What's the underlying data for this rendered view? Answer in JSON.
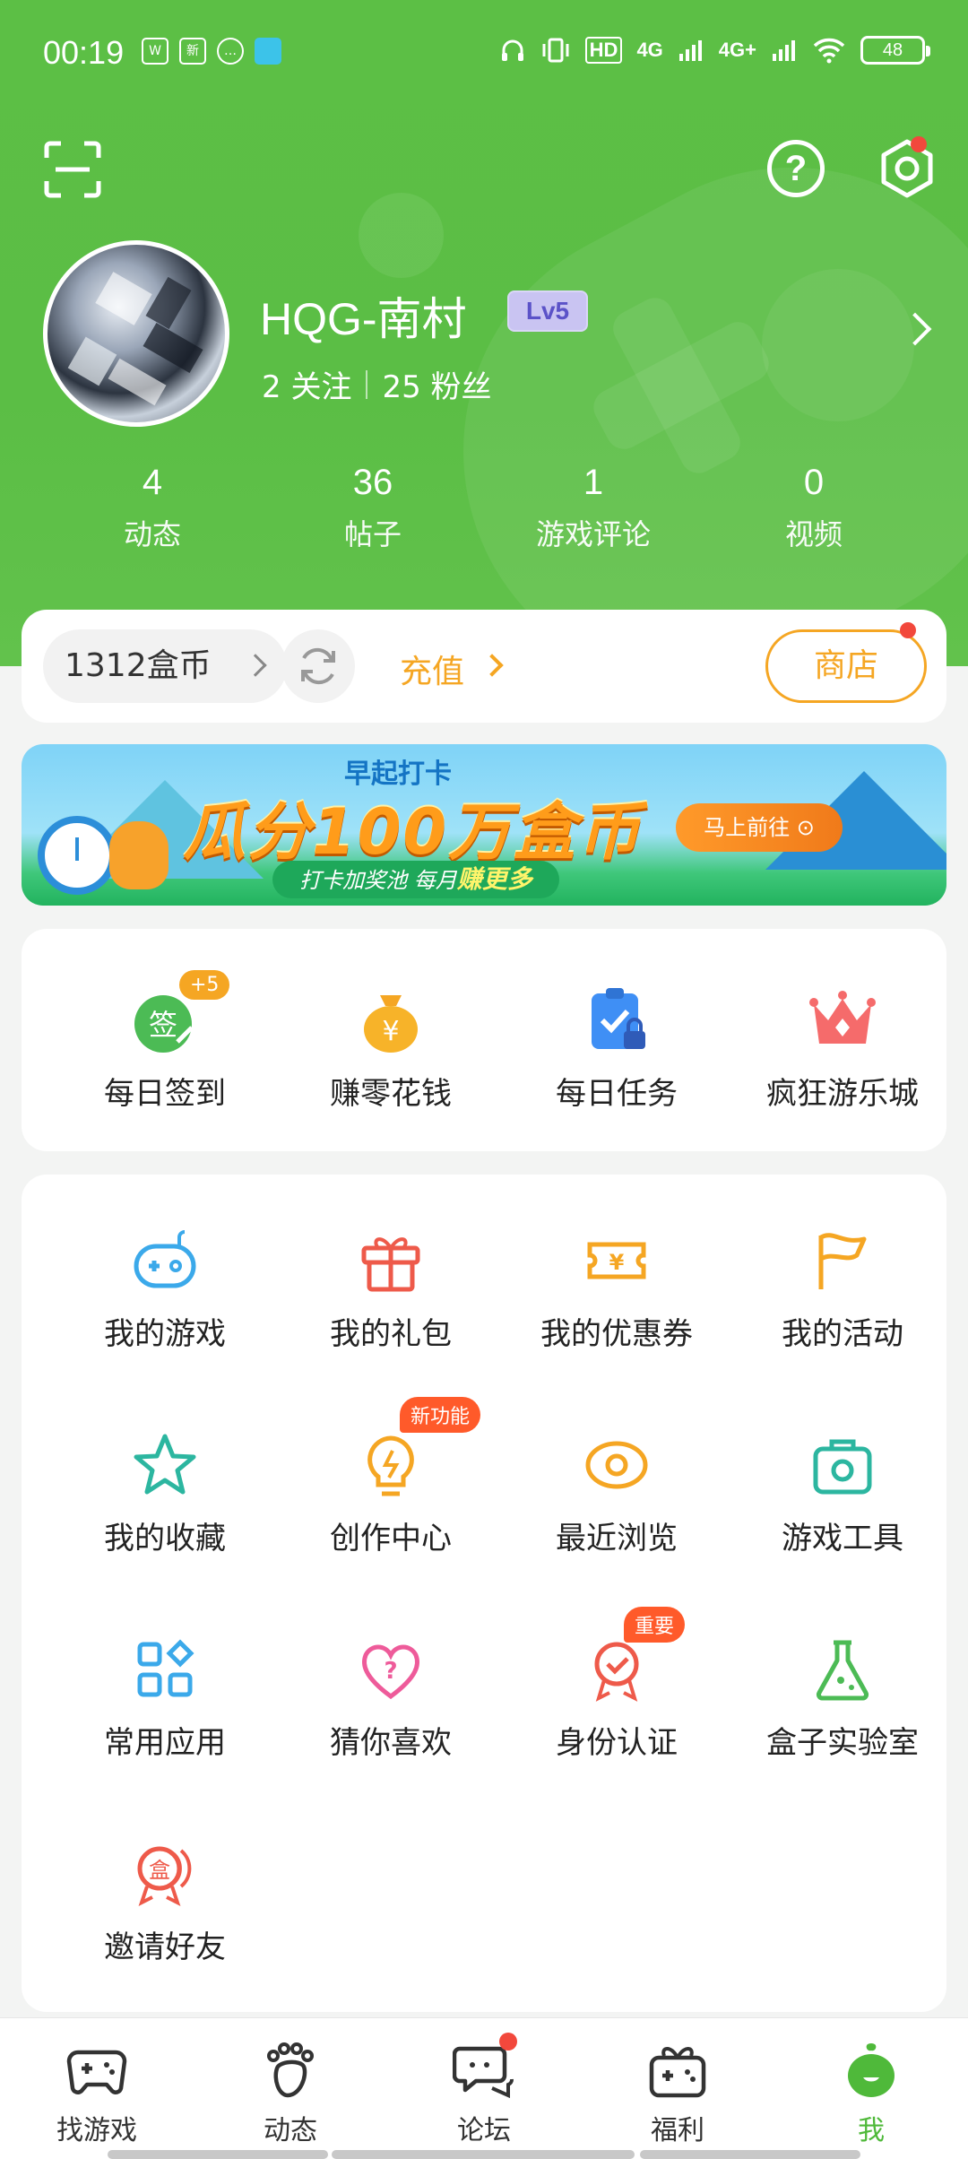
{
  "status_bar": {
    "time": "00:19",
    "battery": "48",
    "network": [
      "HD",
      "4G",
      "4G+"
    ]
  },
  "profile": {
    "username": "HQG-南村",
    "level": "Lv5",
    "following": "2 关注",
    "followers": "25 粉丝"
  },
  "stats": [
    {
      "num": "4",
      "label": "动态"
    },
    {
      "num": "36",
      "label": "帖子"
    },
    {
      "num": "1",
      "label": "游戏评论"
    },
    {
      "num": "0",
      "label": "视频"
    }
  ],
  "coins": {
    "balance": "1312盒币",
    "recharge": "充值",
    "shop": "商店"
  },
  "banner": {
    "subtitle": "早起打卡",
    "title": "瓜分100万盒币",
    "tag_prefix": "打卡加奖池  每月",
    "tag_highlight": "赚更多",
    "button": "马上前往 ⊙"
  },
  "quick_actions": [
    {
      "label": "每日签到",
      "icon": "sign-in-icon",
      "badge": "+5"
    },
    {
      "label": "赚零花钱",
      "icon": "money-bag-icon"
    },
    {
      "label": "每日任务",
      "icon": "task-clipboard-icon"
    },
    {
      "label": "疯狂游乐城",
      "icon": "crown-icon"
    }
  ],
  "features": [
    {
      "label": "我的游戏",
      "icon": "gamepad-icon"
    },
    {
      "label": "我的礼包",
      "icon": "gift-icon"
    },
    {
      "label": "我的优惠券",
      "icon": "coupon-icon"
    },
    {
      "label": "我的活动",
      "icon": "flag-icon"
    },
    {
      "label": "我的收藏",
      "icon": "star-icon"
    },
    {
      "label": "创作中心",
      "icon": "bulb-icon",
      "badge": "新功能"
    },
    {
      "label": "最近浏览",
      "icon": "eye-icon"
    },
    {
      "label": "游戏工具",
      "icon": "toolbox-icon"
    },
    {
      "label": "常用应用",
      "icon": "apps-icon"
    },
    {
      "label": "猜你喜欢",
      "icon": "heart-question-icon"
    },
    {
      "label": "身份认证",
      "icon": "verify-badge-icon",
      "badge": "重要"
    },
    {
      "label": "盒子实验室",
      "icon": "flask-icon"
    },
    {
      "label": "邀请好友",
      "icon": "invite-icon"
    }
  ],
  "tabs": [
    {
      "label": "找游戏",
      "icon": "gamepad-tab-icon"
    },
    {
      "label": "动态",
      "icon": "footprint-icon"
    },
    {
      "label": "论坛",
      "icon": "forum-chat-icon"
    },
    {
      "label": "福利",
      "icon": "gift-game-icon"
    },
    {
      "label": "我",
      "icon": "me-mascot-icon",
      "active": true
    }
  ],
  "colors": {
    "header_green": "#5cbf45",
    "accent_orange": "#f5a623",
    "badge_red": "#ff5a2a",
    "active_tab": "#4fb93a"
  }
}
